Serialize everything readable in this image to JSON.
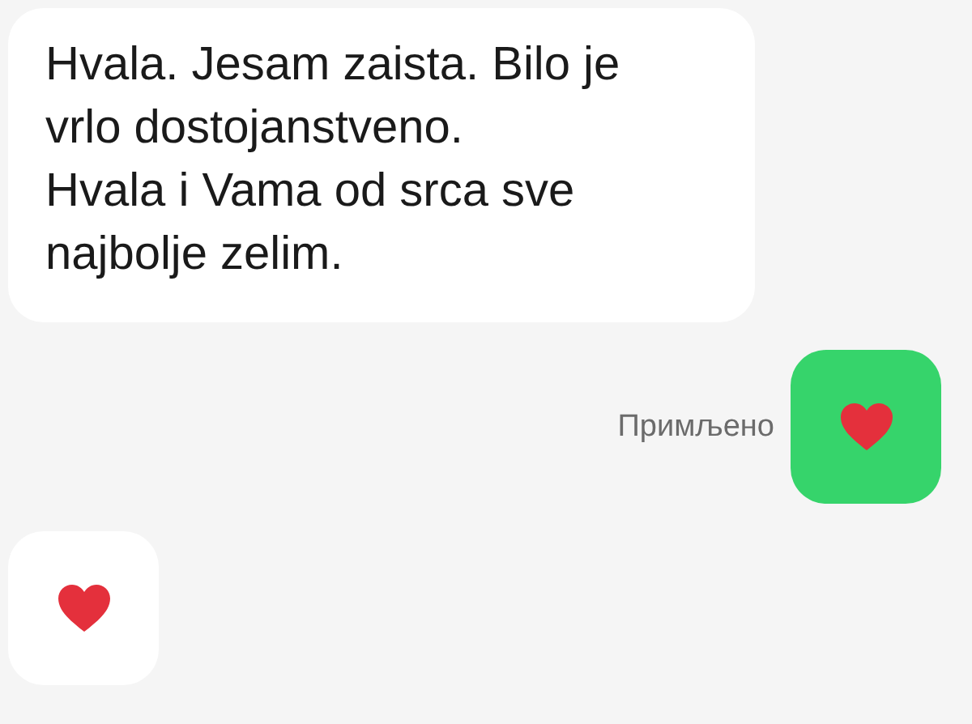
{
  "messages": [
    {
      "outgoing": false,
      "kind": "text",
      "paragraphs": [
        "Hvala. Jesam zaista. Bilo je vrlo dostojanstveno.",
        "Hvala i Vama od srca sve najbolje zelim."
      ]
    },
    {
      "outgoing": true,
      "kind": "heart",
      "status": "Примљено"
    },
    {
      "outgoing": false,
      "kind": "heart"
    }
  ]
}
